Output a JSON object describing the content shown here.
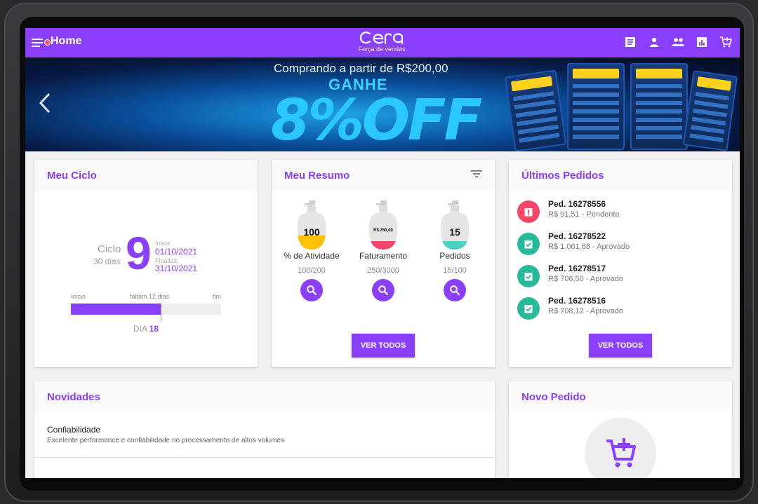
{
  "topbar": {
    "title": "Home",
    "logo_text": "Cera",
    "logo_subtitle": "Força de vendas",
    "icons": [
      "document-icon",
      "person-icon",
      "people-icon",
      "bar-chart-icon",
      "cart-icon"
    ],
    "accent": "#8a3ffc"
  },
  "banner": {
    "line1": "Comprando a partir de R$200,00",
    "line2": "GANHE",
    "line3": "8%OFF"
  },
  "ciclo": {
    "title": "Meu Ciclo",
    "word": "Ciclo",
    "days": "30 dias",
    "number": "9",
    "start_label": "Inicia:",
    "start_date": "01/10/2021",
    "end_label": "Finaliza:",
    "end_date": "31/10/2021",
    "progress_start_label": "início",
    "progress_mid_label": "faltam 12 dias",
    "progress_end_label": "fim",
    "progress_fraction": 0.6,
    "day_label": "DIA",
    "day_value": "18"
  },
  "resumo": {
    "title": "Meu Resumo",
    "items": [
      {
        "bottle_text": "100",
        "label": "% de Atividade",
        "value": "100/200",
        "fill_color": "#ffc107"
      },
      {
        "bottle_text": "R$ 250,00",
        "label": "Faturamento",
        "value": "250/3000",
        "fill_color": "#f2476a"
      },
      {
        "bottle_text": "15",
        "label": "Pedidos",
        "value": "15/100",
        "fill_color": "#4dd0c4"
      }
    ],
    "button": "VER TODOS"
  },
  "pedidos": {
    "title": "Últimos Pedidos",
    "items": [
      {
        "title": "Ped. 16278556",
        "sub": "R$ 91,51 - Pendente",
        "status_color": "#f2476a"
      },
      {
        "title": "Ped. 16278522",
        "sub": "R$ 1.061,68 - Aprovado",
        "status_color": "#26b99a"
      },
      {
        "title": "Ped. 16278517",
        "sub": "R$ 706,50 - Aprovado",
        "status_color": "#26b99a"
      },
      {
        "title": "Ped. 16278516",
        "sub": "R$ 708,12 - Aprovado",
        "status_color": "#26b99a"
      }
    ],
    "button": "VER TODOS"
  },
  "novidades": {
    "title": "Novidades",
    "item_title": "Confiabilidade",
    "item_desc": "Excelente performance e confiabilidade no processamento de altos volumes"
  },
  "novo_pedido": {
    "title": "Novo Pedido"
  }
}
